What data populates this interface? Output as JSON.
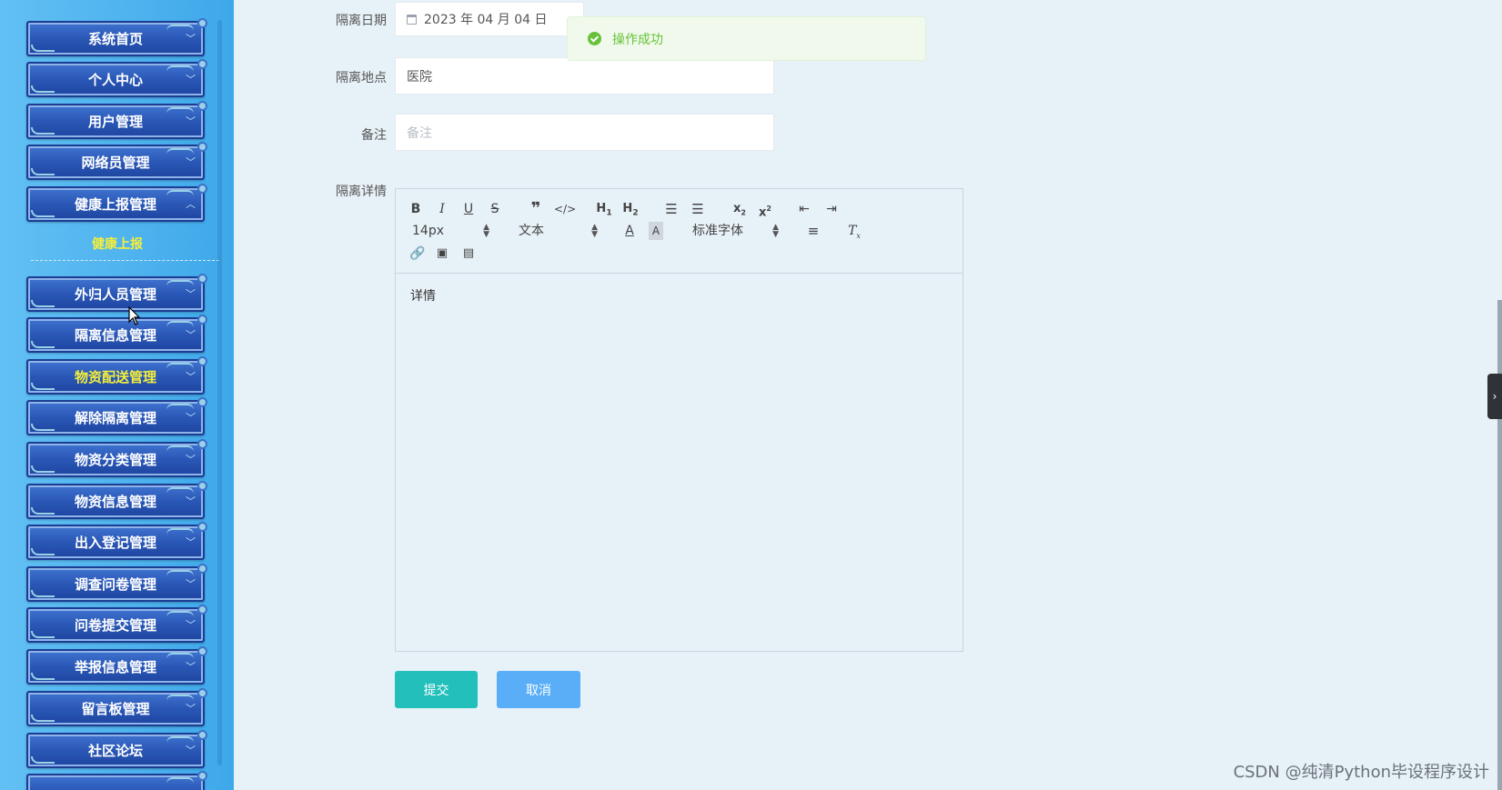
{
  "sidebar": {
    "items": [
      {
        "label": "系统首页"
      },
      {
        "label": "个人中心"
      },
      {
        "label": "用户管理"
      },
      {
        "label": "网络员管理"
      },
      {
        "label": "健康上报管理"
      },
      {
        "label": "外归人员管理"
      },
      {
        "label": "隔离信息管理"
      },
      {
        "label": "物资配送管理"
      },
      {
        "label": "解除隔离管理"
      },
      {
        "label": "物资分类管理"
      },
      {
        "label": "物资信息管理"
      },
      {
        "label": "出入登记管理"
      },
      {
        "label": "调查问卷管理"
      },
      {
        "label": "问卷提交管理"
      },
      {
        "label": "举报信息管理"
      },
      {
        "label": "留言板管理"
      },
      {
        "label": "社区论坛"
      }
    ],
    "submenu_label": "健康上报"
  },
  "form": {
    "date_label": "隔离日期",
    "date_value": "2023 年 04 月 04 日",
    "location_label": "隔离地点",
    "location_value": "医院",
    "remark_label": "备注",
    "remark_placeholder": "备注",
    "detail_label": "隔离详情"
  },
  "editor": {
    "font_size": "14px",
    "header_select": "文本",
    "font_family": "标准字体",
    "content": "详情"
  },
  "toast": {
    "message": "操作成功"
  },
  "buttons": {
    "submit": "提交",
    "cancel": "取消"
  },
  "watermark": "CSDN @纯清Python毕设程序设计",
  "colors": {
    "sidebar_bg": "#4db2ee",
    "menu_btn": "#2a57b6",
    "active_text": "#f4ee3a",
    "submit": "#22bfbb",
    "cancel": "#5aaef8",
    "toast_text": "#67c23a"
  }
}
